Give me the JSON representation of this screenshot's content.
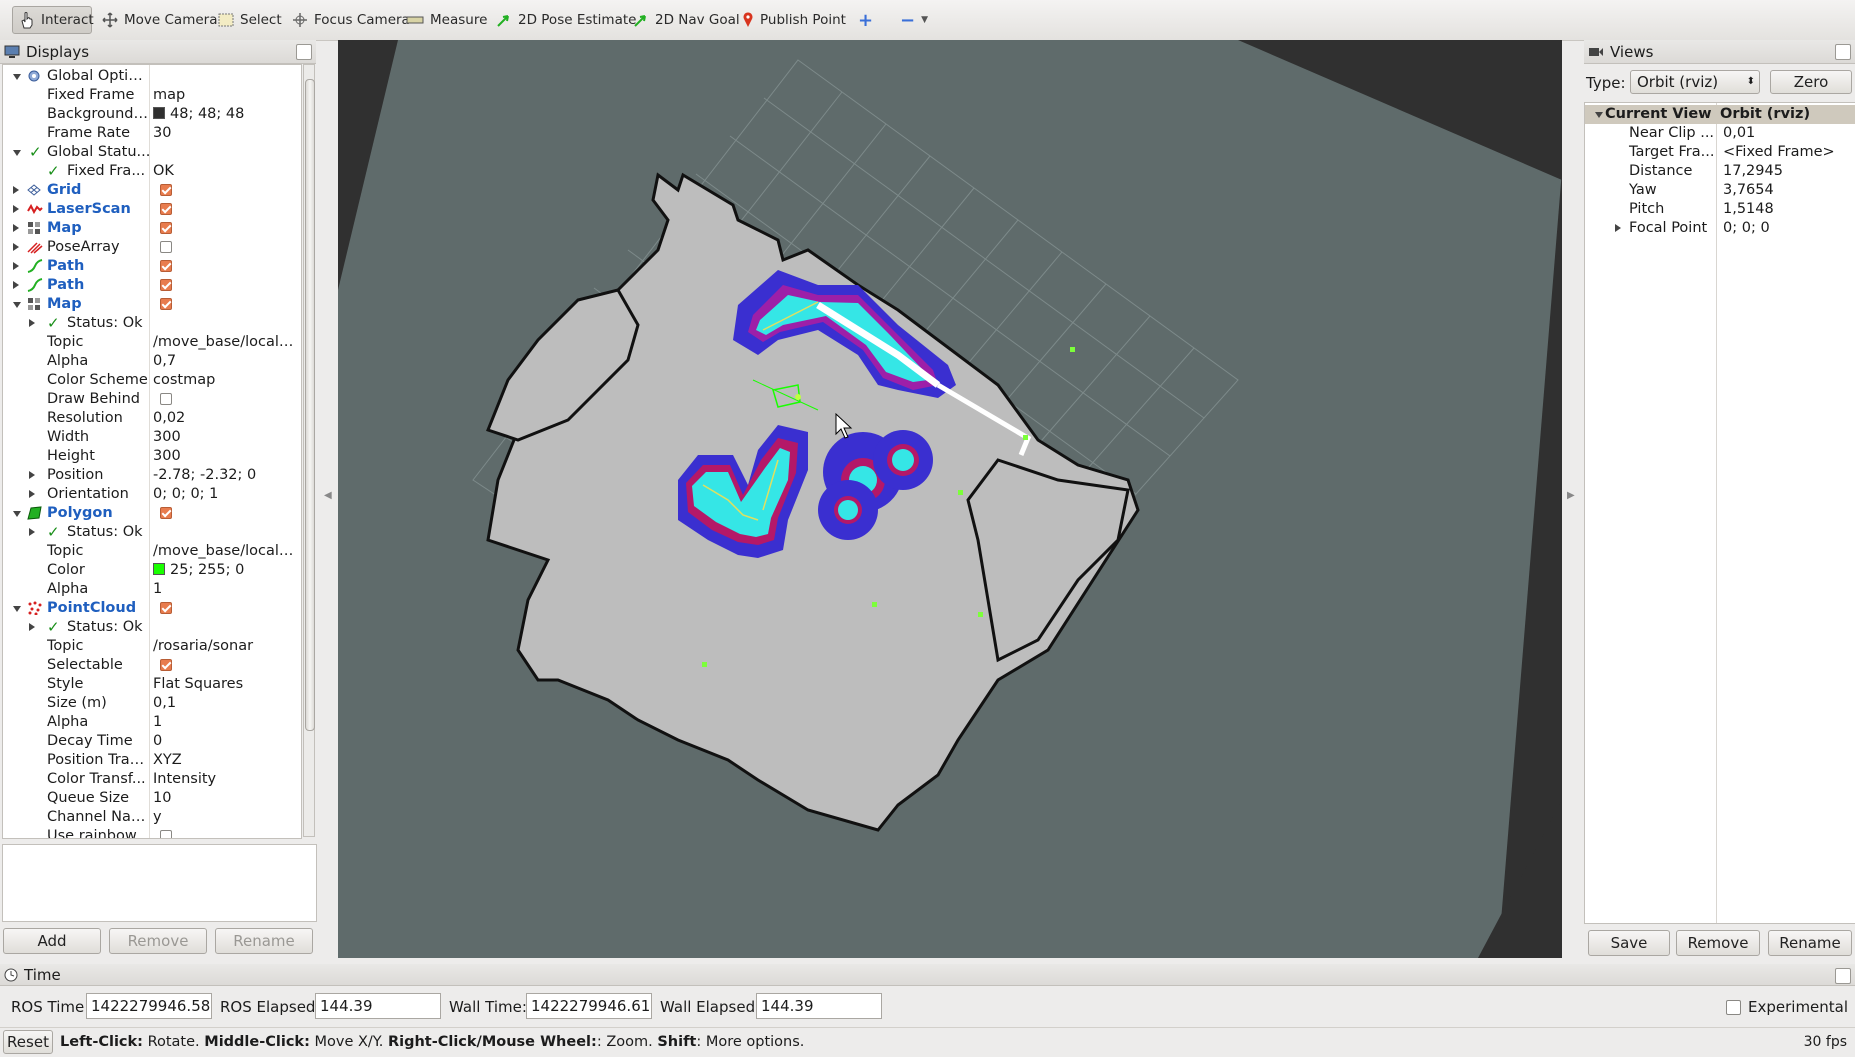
{
  "toolbar": {
    "tools": [
      {
        "label": "Interact",
        "icon": "hand-cursor-icon"
      },
      {
        "label": "Move Camera",
        "icon": "move-arrows-icon"
      },
      {
        "label": "Select",
        "icon": "select-box-icon"
      },
      {
        "label": "Focus Camera",
        "icon": "focus-target-icon"
      },
      {
        "label": "Measure",
        "icon": "ruler-icon"
      },
      {
        "label": "2D Pose Estimate",
        "icon": "green-arrow-icon"
      },
      {
        "label": "2D Nav Goal",
        "icon": "green-arrow-icon"
      },
      {
        "label": "Publish Point",
        "icon": "map-pin-icon"
      }
    ],
    "add_tool": "+",
    "remove_tool": "−"
  },
  "displays": {
    "title": "Displays",
    "rows": [
      {
        "label": "Global Options",
        "value": ""
      },
      {
        "label": "Fixed Frame",
        "value": "map"
      },
      {
        "label": "Background ...",
        "value": "48; 48; 48"
      },
      {
        "label": "Frame Rate",
        "value": "30"
      },
      {
        "label": "Global Statu...",
        "value": ""
      },
      {
        "label": "Fixed Fra...",
        "value": "OK"
      },
      {
        "label": "Grid",
        "value": ""
      },
      {
        "label": "LaserScan",
        "value": ""
      },
      {
        "label": "Map",
        "value": ""
      },
      {
        "label": "PoseArray",
        "value": ""
      },
      {
        "label": "Path",
        "value": ""
      },
      {
        "label": "Path",
        "value": ""
      },
      {
        "label": "Map",
        "value": ""
      },
      {
        "label": "Status: Ok",
        "value": ""
      },
      {
        "label": "Topic",
        "value": "/move_base/local_..."
      },
      {
        "label": "Alpha",
        "value": "0,7"
      },
      {
        "label": "Color Scheme",
        "value": "costmap"
      },
      {
        "label": "Draw Behind",
        "value": ""
      },
      {
        "label": "Resolution",
        "value": "0,02"
      },
      {
        "label": "Width",
        "value": "300"
      },
      {
        "label": "Height",
        "value": "300"
      },
      {
        "label": "Position",
        "value": "-2.78; -2.32; 0"
      },
      {
        "label": "Orientation",
        "value": "0; 0; 0; 1"
      },
      {
        "label": "Polygon",
        "value": ""
      },
      {
        "label": "Status: Ok",
        "value": ""
      },
      {
        "label": "Topic",
        "value": "/move_base/local_..."
      },
      {
        "label": "Color",
        "value": "25; 255; 0"
      },
      {
        "label": "Alpha",
        "value": "1"
      },
      {
        "label": "PointCloud",
        "value": ""
      },
      {
        "label": "Status: Ok",
        "value": ""
      },
      {
        "label": "Topic",
        "value": "/rosaria/sonar"
      },
      {
        "label": "Selectable",
        "value": ""
      },
      {
        "label": "Style",
        "value": "Flat Squares"
      },
      {
        "label": "Size (m)",
        "value": "0,1"
      },
      {
        "label": "Alpha",
        "value": "1"
      },
      {
        "label": "Decay Time",
        "value": "0"
      },
      {
        "label": "Position Tran...",
        "value": "XYZ"
      },
      {
        "label": "Color Transf...",
        "value": "Intensity"
      },
      {
        "label": "Queue Size",
        "value": "10"
      },
      {
        "label": "Channel Name",
        "value": "y"
      },
      {
        "label": "Use rainbow",
        "value": ""
      }
    ],
    "buttons": {
      "add": "Add",
      "remove": "Remove",
      "rename": "Rename"
    }
  },
  "views": {
    "title": "Views",
    "type_label": "Type:",
    "type_value": "Orbit (rviz)",
    "zero": "Zero",
    "header": {
      "name": "Current View",
      "value": "Orbit (rviz)"
    },
    "rows": [
      {
        "label": "Near Clip ...",
        "value": "0,01"
      },
      {
        "label": "Target Fra...",
        "value": "<Fixed Frame>"
      },
      {
        "label": "Distance",
        "value": "17,2945"
      },
      {
        "label": "Yaw",
        "value": "3,7654"
      },
      {
        "label": "Pitch",
        "value": "1,5148"
      },
      {
        "label": "Focal Point",
        "value": "0; 0; 0"
      }
    ],
    "buttons": {
      "save": "Save",
      "remove": "Remove",
      "rename": "Rename"
    }
  },
  "time": {
    "title": "Time",
    "ros_time_label": "ROS Time:",
    "ros_time": "1422279946.58",
    "ros_elapsed_label": "ROS Elapsed:",
    "ros_elapsed": "144.39",
    "wall_time_label": "Wall Time:",
    "wall_time": "1422279946.61",
    "wall_elapsed_label": "Wall Elapsed:",
    "wall_elapsed": "144.39",
    "experimental": "Experimental"
  },
  "status": {
    "reset": "Reset",
    "k1": "Left-Click:",
    "t1": "Rotate.",
    "k2": "Middle-Click:",
    "t2": "Move X/Y.",
    "k3": "Right-Click/Mouse Wheel:",
    "t3": ": Zoom.",
    "k4": "Shift",
    "t4": ": More options.",
    "fps": "30 fps"
  },
  "colors": {
    "background": "#303030",
    "ground_plane": "#5f6b6b",
    "map_free": "#bdbdbd",
    "costmap_inflation": "#3a2fd0",
    "costmap_lethal": "#e0106e",
    "costmap_core": "#35e6e6",
    "polygon_green": "#19ff00"
  }
}
